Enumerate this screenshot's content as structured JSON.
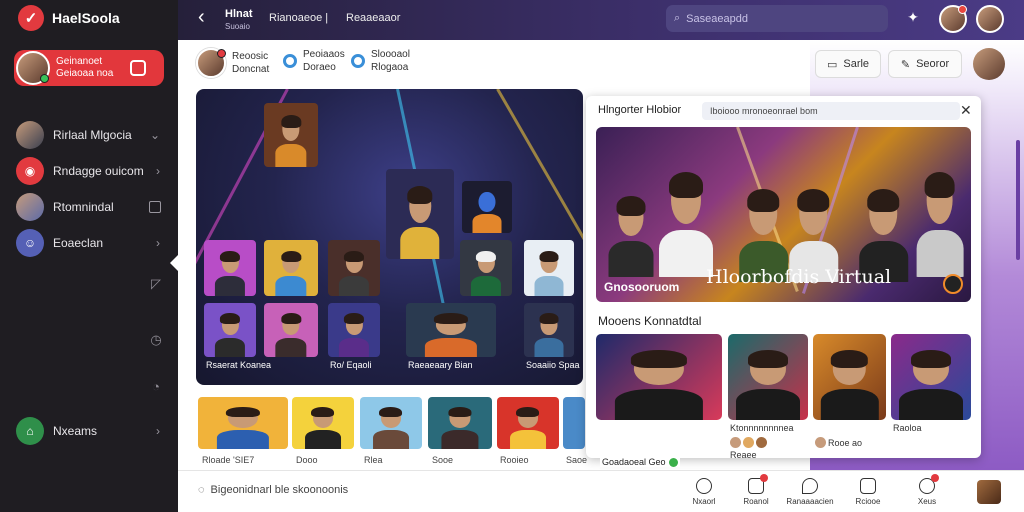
{
  "app": {
    "name": "HaelSoola"
  },
  "sidebar": {
    "profile": {
      "line1": "Geinanoet",
      "line2": "Geiaoaa noa"
    },
    "items": [
      {
        "label": "Rirlaal Mlgocia",
        "icon": "user-avatar-icon",
        "color": "#3a3f50"
      },
      {
        "label": "Rndagge ouicom",
        "icon": "broadcast-icon",
        "color": "#e23a3f"
      },
      {
        "label": "Rtomnindal",
        "icon": "user-avatar-icon",
        "color": "#5b6aa8"
      },
      {
        "label": "Eoaeclan",
        "icon": "group-icon",
        "color": "#5560b5"
      },
      {
        "label": "Nxeams",
        "icon": "home-icon",
        "color": "#2f8f4a"
      }
    ]
  },
  "topbar": {
    "title": "Hlnat",
    "subtitle": "Suoaio",
    "link1": "Rianoaeoe |",
    "link2": "Reaaeaaor",
    "search_placeholder": "Saseaeapdd"
  },
  "stories": [
    {
      "line1": "Reoosic",
      "line2": "Doncnat"
    },
    {
      "line1": "Peoiaaos",
      "line2": "Doraeo"
    },
    {
      "line1": "Sloooaol",
      "line2": "Rlogaoa"
    }
  ],
  "actions": {
    "button1": "Sarle",
    "button2": "Seoror"
  },
  "main_card": {
    "caption_left": "Rsaerat Koanea",
    "caption_mid": "Ro/ Eqaoli",
    "caption_right_a": "Raeaeaary Bian",
    "caption_right_b": "Soaaiio Spaa"
  },
  "thumbs": [
    {
      "label": "Rloade 'SIE7"
    },
    {
      "label": "Dooo"
    },
    {
      "label": "Rlea"
    },
    {
      "label": "Sooe"
    },
    {
      "label": "Rooieo"
    },
    {
      "label": "Saoe"
    }
  ],
  "panel": {
    "title": "Hlngorter Hlobior",
    "tag": "Iboiooo mronoeonrael bom",
    "feature_caption": "Gnosooruom",
    "feature_title": "Hloorbofdis Virtual",
    "section_title": "Mooens Konnatdtal",
    "cards": [
      {
        "name": "Goadaoeal Geo",
        "verified": true
      },
      {
        "name": "Ktonnnnnnnnea",
        "sub": "Reaee"
      },
      {
        "name": "Rooe ao",
        "sub": ""
      },
      {
        "name": "Raoloa",
        "sub": ""
      }
    ]
  },
  "bottombar": {
    "compose": "Bigeonidnarl ble skoonoonis",
    "nav": [
      {
        "label": "Nxaorl",
        "badge": false
      },
      {
        "label": "Roanol",
        "badge": true
      },
      {
        "label": "Ranaaaacien",
        "badge": false
      },
      {
        "label": "Rciooe",
        "badge": false
      },
      {
        "label": "Xeus",
        "badge": true
      }
    ]
  },
  "colors": {
    "accent": "#e23a3f",
    "topbar": "#3c2f6a",
    "sidebar": "#1f1d22",
    "purple": "#8d5bc4"
  }
}
